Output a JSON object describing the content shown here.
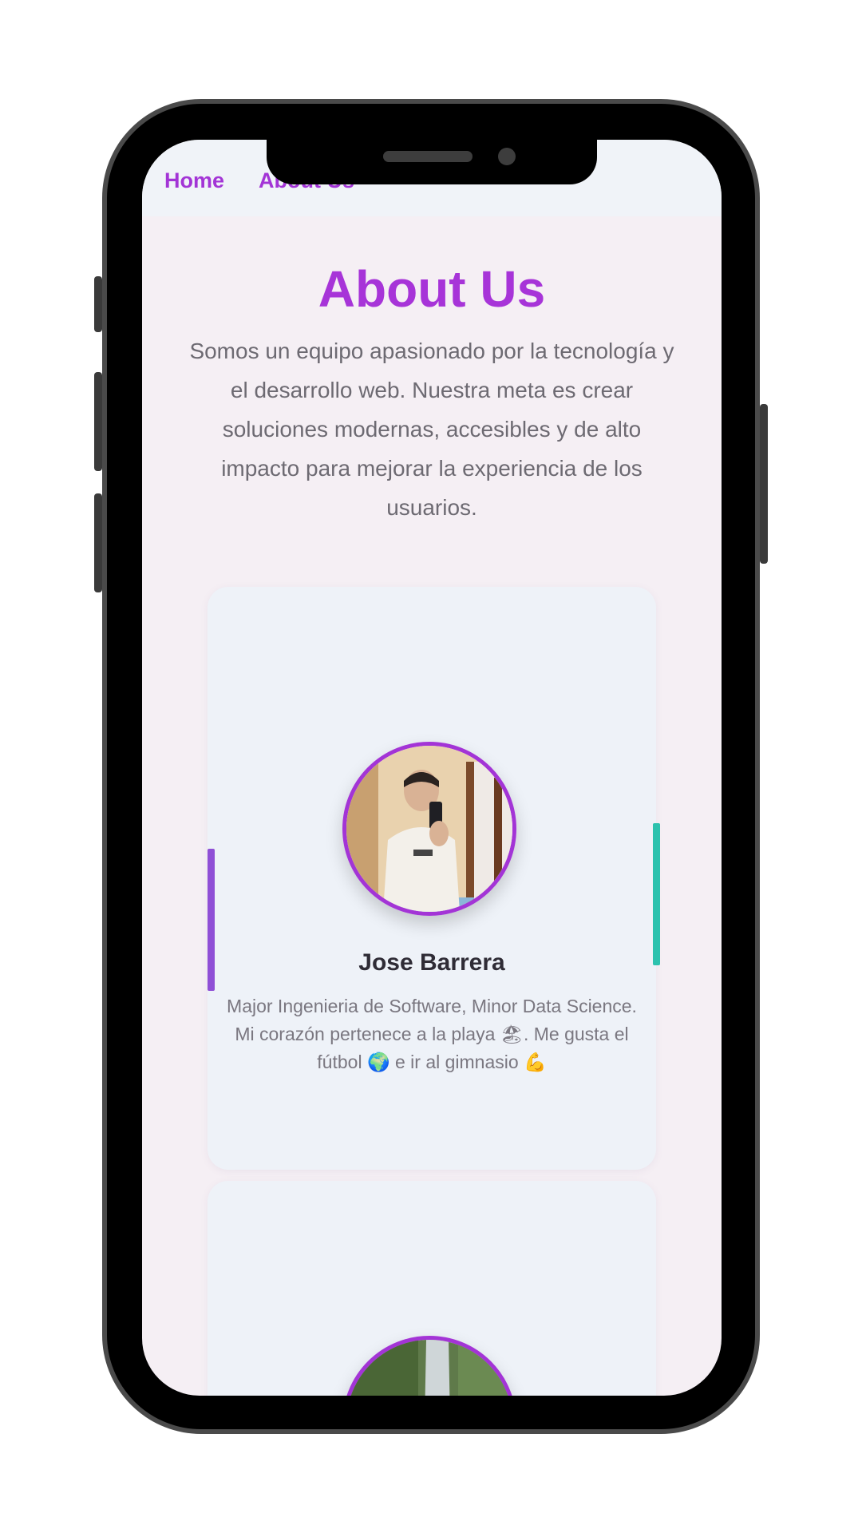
{
  "nav": {
    "items": [
      {
        "label": "Home"
      },
      {
        "label": "About Us"
      }
    ]
  },
  "page": {
    "title": "About Us",
    "intro": "Somos un equipo apasionado por la tecnología y el desarrollo web. Nuestra meta es crear soluciones modernas, accesibles y de alto impacto para mejorar la experiencia de los usuarios."
  },
  "team": [
    {
      "name": "Jose Barrera",
      "bio": "Major Ingenieria de Software, Minor Data Science. Mi corazón pertenece a la playa 🏖. Me gusta el fútbol 🌍 e ir al gimnasio 💪"
    }
  ],
  "colors": {
    "accent": "#a734d8",
    "teal": "#2cc2ae",
    "purple_bar": "#8f4fd6",
    "background": "#f5eff4",
    "card": "#eef2f8"
  }
}
